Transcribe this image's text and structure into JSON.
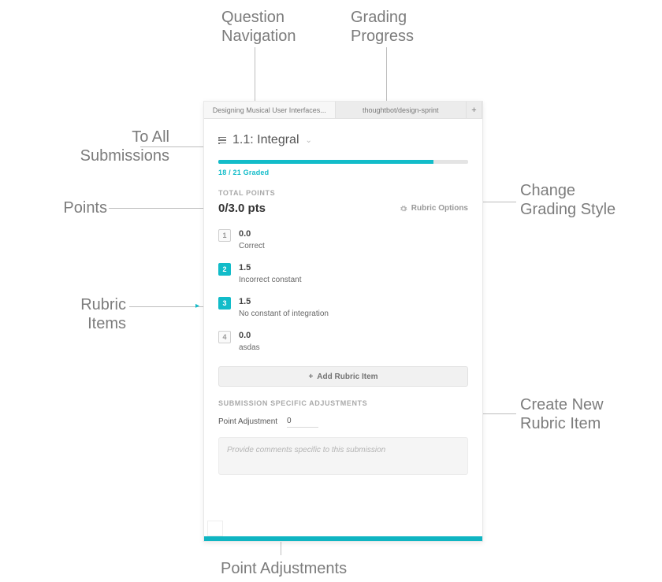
{
  "annotations": {
    "qnav": "Question\nNavigation",
    "progress": "Grading\nProgress",
    "to_all": "To All\nSubmissions",
    "points": "Points",
    "rubric_items": "Rubric\nItems",
    "change_style": "Change\nGrading Style",
    "create_item": "Create New\nRubric Item",
    "point_adj": "Point Adjustments"
  },
  "tabs": {
    "left": "Designing Musical User Interfaces...",
    "right": "thoughtbot/design-sprint",
    "plus": "+"
  },
  "question": {
    "title": "1.1: Integral"
  },
  "progress": {
    "pct": 86,
    "label": "18 / 21 Graded"
  },
  "labels": {
    "total_points": "TOTAL POINTS",
    "rubric_options": "Rubric Options",
    "add_rubric": "Add Rubric Item",
    "ssa": "SUBMISSION SPECIFIC ADJUSTMENTS",
    "point_adjustment": "Point Adjustment",
    "comment_placeholder": "Provide comments specific to this submission"
  },
  "points": {
    "display": "0/3.0 pts"
  },
  "adjustment": {
    "value": "0"
  },
  "rubric": [
    {
      "n": "1",
      "selected": false,
      "pts": "0.0",
      "desc": "Correct"
    },
    {
      "n": "2",
      "selected": true,
      "pts": "1.5",
      "desc": "Incorrect constant"
    },
    {
      "n": "3",
      "selected": true,
      "pts": "1.5",
      "desc": "No constant of integration"
    },
    {
      "n": "4",
      "selected": false,
      "pts": "0.0",
      "desc": "asdas"
    }
  ]
}
